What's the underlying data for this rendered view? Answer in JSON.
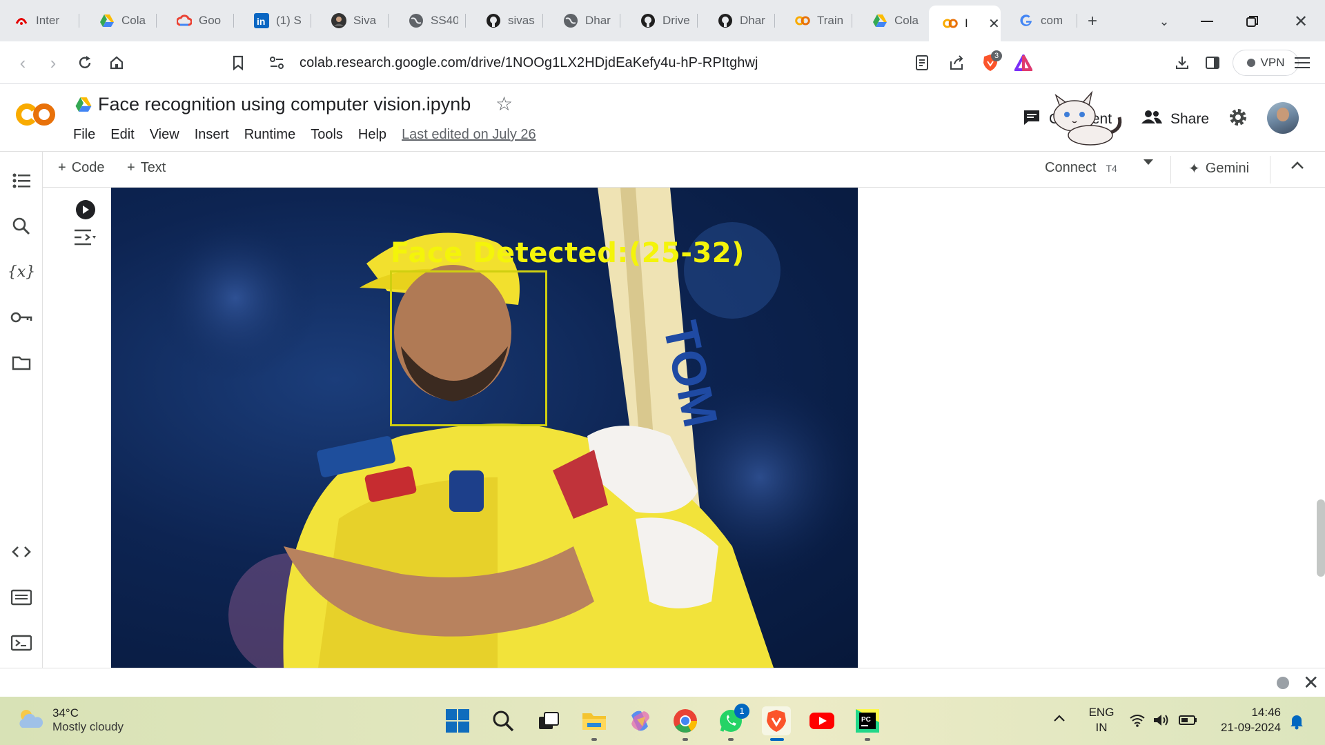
{
  "browser": {
    "tabs": [
      {
        "title": "Inter",
        "icon": "airtel-icon"
      },
      {
        "title": "Cola",
        "icon": "google-drive-icon"
      },
      {
        "title": "Goo",
        "icon": "google-cloud-icon"
      },
      {
        "title": "(1) S",
        "icon": "linkedin-icon"
      },
      {
        "title": "Siva",
        "icon": "profile-icon"
      },
      {
        "title": "SS40",
        "icon": "globe-icon"
      },
      {
        "title": "sivas",
        "icon": "github-icon"
      },
      {
        "title": "Dhar",
        "icon": "globe-icon"
      },
      {
        "title": "Drive",
        "icon": "github-icon"
      },
      {
        "title": "Dhar",
        "icon": "github-icon"
      },
      {
        "title": "Train",
        "icon": "colab-icon"
      },
      {
        "title": "Cola",
        "icon": "google-drive-icon"
      },
      {
        "title": "I",
        "icon": "colab-icon",
        "active": true
      },
      {
        "title": "com",
        "icon": "google-icon"
      }
    ],
    "url": "colab.research.google.com/drive/1NOOg1LX2HDjdEaKefy4u-hP-RPItghwj",
    "brave_badge": "3",
    "vpn_label": "VPN"
  },
  "colab": {
    "logo": "CO",
    "title": "Face recognition using computer vision.ipynb",
    "menu": [
      "File",
      "Edit",
      "View",
      "Insert",
      "Runtime",
      "Tools",
      "Help"
    ],
    "last_edited": "Last edited on July 26",
    "comment_label": "Comment",
    "share_label": "Share",
    "toolbar": {
      "add_code": "Code",
      "add_text": "Text",
      "connect": "Connect",
      "runtime_type": "T4",
      "gemini": "Gemini"
    },
    "output": {
      "face_label": "Face Detected:(25-32)"
    }
  },
  "taskbar": {
    "temperature": "34°C",
    "weather": "Mostly cloudy",
    "lang_line1": "ENG",
    "lang_line2": "IN",
    "time": "14:46",
    "date": "21-09-2024",
    "whatsapp_badge": "1"
  },
  "colors": {
    "colab_orange": "#e8710a",
    "colab_yellow": "#f9ab00",
    "detection_yellow": "#f4f40a",
    "windows_blue": "#0067c0"
  }
}
